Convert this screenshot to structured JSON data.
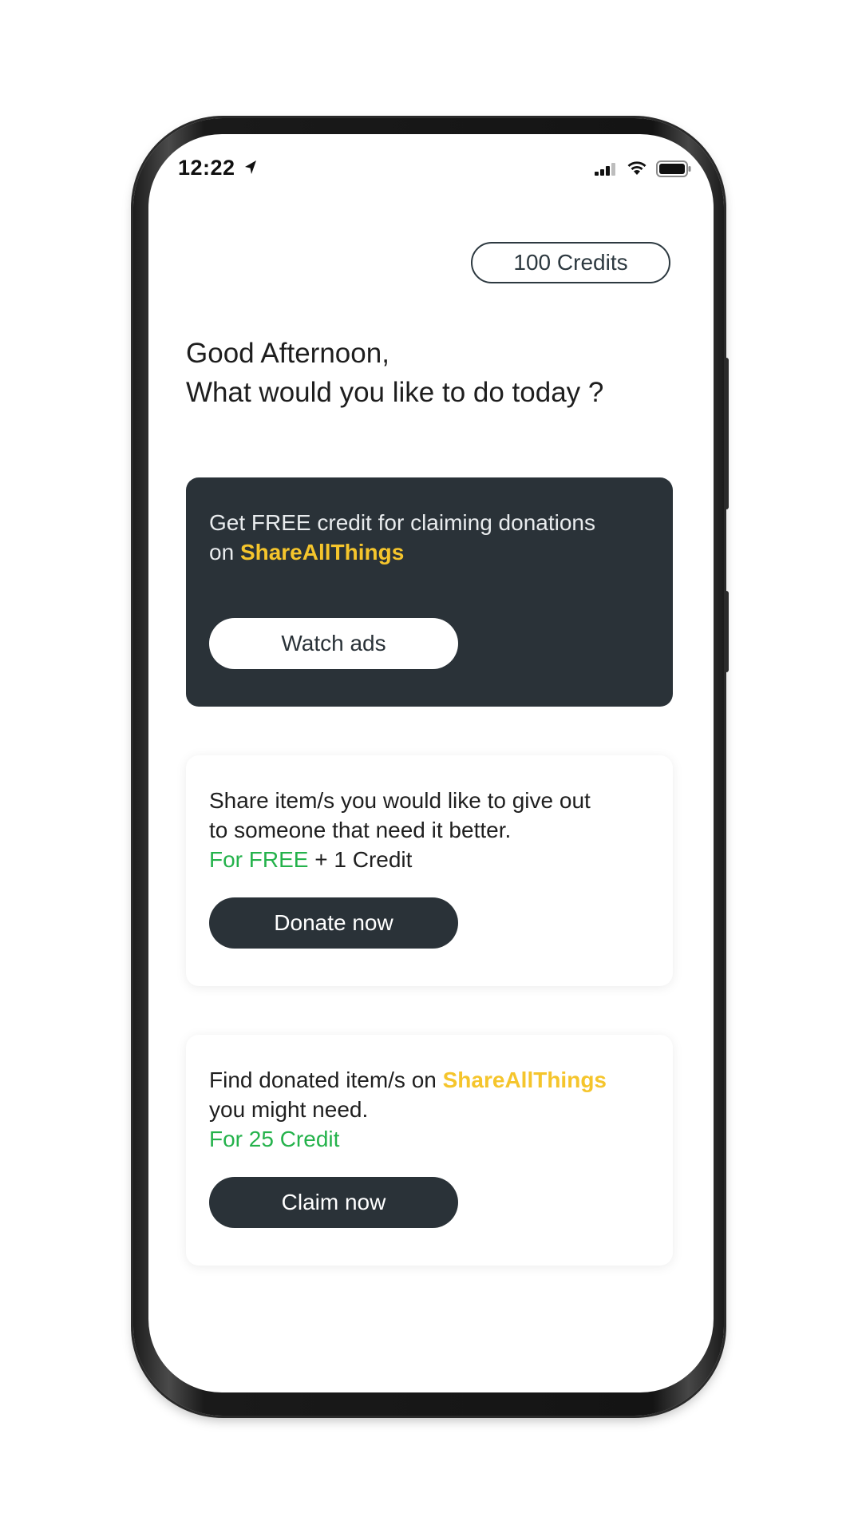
{
  "status_bar": {
    "time": "12:22",
    "location_icon": "location-arrow-icon",
    "signal_icon": "cellular-signal-icon",
    "wifi_icon": "wifi-icon",
    "battery_icon": "battery-icon"
  },
  "header": {
    "credits_label": "100 Credits"
  },
  "greeting": {
    "line1": "Good Afternoon,",
    "line2": "What would you like to do today ?"
  },
  "cards": {
    "ads": {
      "line1": "Get FREE credit for claiming donations",
      "line2_prefix": "on ",
      "brand": "ShareAllThings",
      "button_label": "Watch ads"
    },
    "donate": {
      "line1": "Share item/s you would like to give out",
      "line2": "to someone that need it better.",
      "price_highlight": "For FREE",
      "price_rest": " + 1 Credit",
      "button_label": "Donate now"
    },
    "claim": {
      "line1_prefix": "Find donated item/s on ",
      "brand": "ShareAllThings",
      "line2": "you might need.",
      "price_highlight": "For 25 Credit",
      "button_label": "Claim now"
    }
  },
  "colors": {
    "dark_card": "#2a3238",
    "brand_yellow": "#f5c52c",
    "accent_green": "#24b24b"
  }
}
